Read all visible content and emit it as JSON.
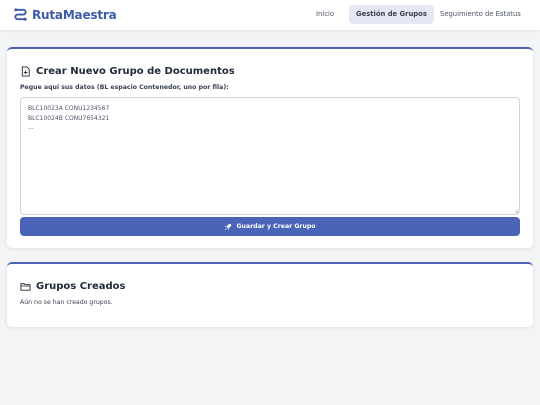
{
  "app": {
    "brand": "RutaMaestra",
    "brand_icon": "route-icon",
    "accent_color": "#4a64b8"
  },
  "nav": {
    "items": [
      {
        "label": "Inicio",
        "active": false
      },
      {
        "label": "Gestión de Grupos",
        "active": true
      },
      {
        "label": "Seguimiento de Estatus",
        "active": false
      }
    ]
  },
  "create_group": {
    "icon": "file-plus-icon",
    "title": "Crear Nuevo Grupo de Documentos",
    "field_label": "Pegue aquí sus datos (BL espacio Contenedor, uno por fila):",
    "textarea_value": "BLC10023A CONU1234567\nBLC10024B CONU7654321\n...",
    "submit_icon": "rocket-icon",
    "submit_label": "Guardar y Crear Grupo"
  },
  "groups": {
    "icon": "folder-icon",
    "title": "Grupos Creados",
    "empty_message": "Aún no se han creado grupos."
  }
}
